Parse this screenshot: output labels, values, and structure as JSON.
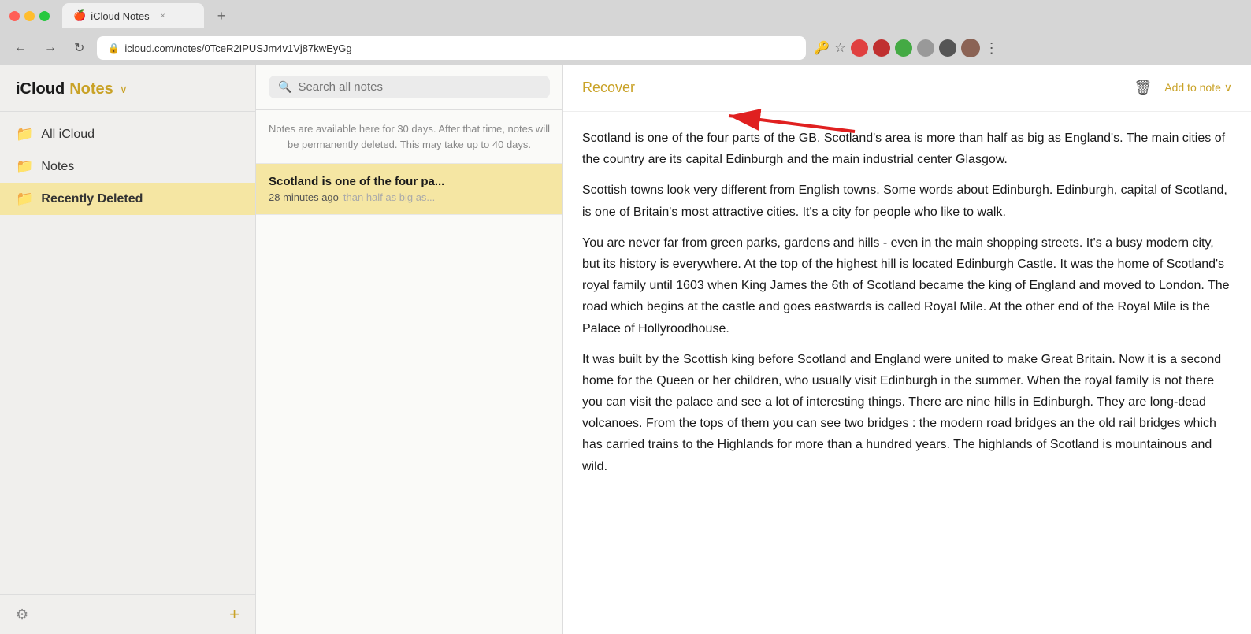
{
  "browser": {
    "tab_title": "iCloud Notes",
    "tab_favicon": "🍎",
    "close_tab_label": "×",
    "new_tab_label": "+",
    "nav_back": "←",
    "nav_forward": "→",
    "nav_refresh": "C",
    "url": "icloud.com/notes/0TceR2IPUSJm4v1Vj87kwEyGg",
    "lock_icon": "🔒",
    "more_options": "⋮"
  },
  "sidebar": {
    "app_name_prefix": "iCloud",
    "app_name_suffix": "Notes",
    "chevron": "∨",
    "items": [
      {
        "id": "all-icloud",
        "label": "All iCloud",
        "icon": "📁"
      },
      {
        "id": "notes",
        "label": "Notes",
        "icon": "📁"
      },
      {
        "id": "recently-deleted",
        "label": "Recently Deleted",
        "icon": "📁"
      }
    ],
    "active_item": "recently-deleted",
    "add_button_label": "+"
  },
  "notes_list": {
    "search_placeholder": "Search all notes",
    "info_banner": "Notes are available here for 30 days. After that time, notes will be permanently deleted. This may take up to 40 days.",
    "notes": [
      {
        "id": "note-1",
        "title": "Scotland is one of the four pa...",
        "time": "28 minutes ago",
        "preview": "than half as big as..."
      }
    ]
  },
  "note": {
    "recover_label": "Recover",
    "delete_icon": "🗑",
    "more_options_label": "Add to note ∨",
    "body_paragraphs": [
      "Scotland is one of the four parts of the GB. Scotland's area is more than half as big as England's. The main cities of the country are its capital Edinburgh and the main industrial center Glasgow.",
      "Scottish towns look very different from English towns. Some words about Edinburgh. Edinburgh, capital of Scotland, is one of Britain's most attractive cities. It's a city for people who like to walk.",
      "You are never far from green parks, gardens and hills - even in the main shopping streets. It's a busy modern city, but its history is everywhere. At the top of the highest hill is located Edinburgh Castle. It was the home of Scotland's royal family until 1603 when King James the 6th of Scotland became the king of England and moved to London. The road which begins at the castle and goes eastwards is called Royal Mile. At the other end of the Royal Mile is the Palace of Hollyroodhouse.",
      "It was built by the Scottish king before Scotland and England were united to make Great Britain. Now it is a second home for the Queen or her children, who usually visit Edinburgh in the summer. When the royal family is not there you can visit the palace and see a lot of interesting things. There are nine hills in Edinburgh. They are long-dead volcanoes. From the tops of them you can see two bridges : the modern road bridges an the old rail bridges which has carried trains to the Highlands for more than a hundred years. The highlands of Scotland is mountainous and wild."
    ]
  },
  "colors": {
    "gold": "#c9a227",
    "selected_bg": "#f5e6a3",
    "body_text": "#1a1a1a",
    "muted_text": "#888888"
  }
}
